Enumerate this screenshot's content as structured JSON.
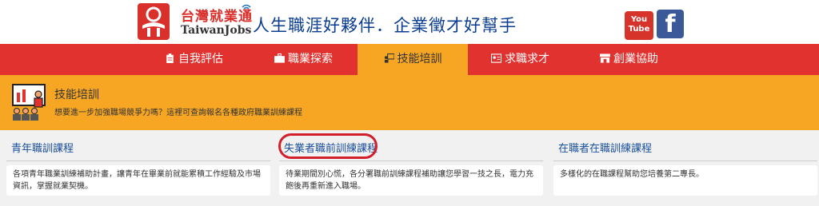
{
  "brand": {
    "name_cn": "台灣就業通",
    "name_en": "TaiwanJobs",
    "slogan": "人生職涯好夥伴．企業徵才好幫手",
    "color": "#d9302c"
  },
  "social": {
    "youtube_line1": "You",
    "youtube_line2": "Tube",
    "facebook": "f"
  },
  "nav": {
    "color": "#e1322f",
    "active_color": "#f6a623",
    "items": [
      {
        "label": "自我評估",
        "icon": "clipboard-icon"
      },
      {
        "label": "職業探索",
        "icon": "briefcase-icon"
      },
      {
        "label": "技能培訓",
        "icon": "teacher-icon",
        "active": true
      },
      {
        "label": "求職求才",
        "icon": "id-card-icon"
      },
      {
        "label": "創業協助",
        "icon": "store-icon"
      }
    ]
  },
  "banner": {
    "title": "技能培訓",
    "subtitle": "想要進一步加強職場競爭力嗎？這裡可查詢報名各種政府職業訓練課程",
    "icon": "classroom-icon"
  },
  "cards": [
    {
      "title": "青年職訓課程",
      "body": "各項青年職業訓練補助計畫，讓青年在畢業前就能累積工作經驗及市場資訊，掌握就業契機。"
    },
    {
      "title": "失業者職前訓練課程",
      "body": "待業期間別心慌，各分署職前訓練課程補助讓您學習一技之長，電力充飽後再重新進入職場。",
      "highlighted": true
    },
    {
      "title": "在職者在職訓練課程",
      "body": "多樣化的在職課程幫助您培養第二專長。"
    }
  ]
}
